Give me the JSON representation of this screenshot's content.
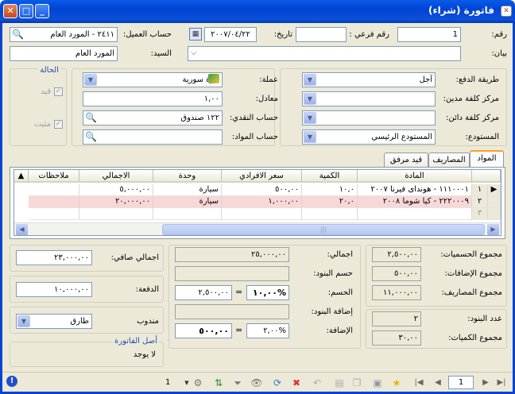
{
  "window": {
    "title": "فاتورة (شراء)",
    "close_glyph": "✕",
    "max_glyph": "□",
    "min_glyph": "_",
    "app_glyph": "✕"
  },
  "header": {
    "number_label": "رقم:",
    "number_value": "1",
    "subnumber_label": "رقم فرعي :",
    "subnumber_value": "",
    "date_label": "تاريخ:",
    "date_value": "٢٠٠٧/٠٤/٢٢",
    "customer_label": "حساب العميل:",
    "customer_value": "٢٤١١ - المورد العام",
    "statement_label": "بيان:",
    "statement_value": "",
    "mister_label": "السيد:",
    "mister_value": "المورد العام"
  },
  "payment": {
    "method_label": "طريقة الدفع:",
    "method_value": "آجل",
    "debit_center_label": "مركز كلفة مدين:",
    "debit_center_value": "",
    "credit_center_label": "مركز كلفة دائن:",
    "credit_center_value": "",
    "warehouse_label": "المستودع:",
    "warehouse_value": "المستودع الرئيسي"
  },
  "currency": {
    "currency_label": "عملة:",
    "currency_value": "ليرة سورية",
    "rate_label": "معادل:",
    "rate_value": "١,٠٠",
    "cash_label": "حساب النقدي:",
    "cash_value": "١٢٢ صندوق",
    "materials_label": "حساب المواد:",
    "materials_value": ""
  },
  "status": {
    "title": "الحالة",
    "registered_label": "قيد",
    "posted_label": "مثبت"
  },
  "tabs": [
    {
      "label": "المواد"
    },
    {
      "label": "المصاريف"
    },
    {
      "label": "قيد مرفق"
    }
  ],
  "grid": {
    "headers": [
      "المادة",
      "الكمية",
      "سعر الافرادي",
      "وحدة",
      "الاجمالي",
      "ملاحظات"
    ],
    "rows": [
      {
        "num": "١",
        "material": "١١١٠٠٠١ - هوندای فيرنا ٢٠٠٧",
        "qty": "١٠,٠",
        "price": "٥٠٠,٠٠",
        "unit": "سيارة",
        "total": "٥,٠٠٠,٠٠",
        "notes": ""
      },
      {
        "num": "٢",
        "material": "٢٢٢٠٠٠٩ - كيا شوما ٢٠٠٨",
        "qty": "٢٠,٠",
        "price": "١,٠٠٠,٠٠",
        "unit": "سيارة",
        "total": "٢٠,٠٠٠,٠٠",
        "notes": ""
      },
      {
        "num": "٣",
        "material": "",
        "qty": "",
        "price": "",
        "unit": "",
        "total": "",
        "notes": ""
      }
    ]
  },
  "totals_left": {
    "net_label": "اجمالي صافي:",
    "net_value": "٢٣,٠٠٠,٠٠",
    "paid_label": "الدفعة:",
    "paid_value": "١٠,٠٠٠,٠٠",
    "rep_label": "مندوب",
    "rep_value": "طارق",
    "origin_label": "أصل الفاتورة",
    "origin_value": "لا يوجد"
  },
  "totals_mid": {
    "total_label": "اجمالي:",
    "total_value": "٢٥,٠٠٠,٠٠",
    "item_disc_label": "حسم البنود:",
    "item_disc_value": "",
    "disc_label": "الحسم:",
    "disc_pct": "%١٠,٠٠",
    "disc_value": "٢,٥٠٠,٠٠",
    "eq": "=",
    "item_add_label": "إضافة البنود:",
    "item_add_value": "",
    "add_label": "الإضافة:",
    "add_pct": "%٢,٠٠",
    "add_value": "٥٠٠,٠٠"
  },
  "totals_right": {
    "disc_sum_label": "مجموع الحسميات:",
    "disc_sum_value": "٢,٥٠٠,٠٠",
    "add_sum_label": "مجموع الإضافات:",
    "add_sum_value": "٥٠٠,٠٠",
    "exp_sum_label": "مجموع المصاريف:",
    "exp_sum_value": "١١,٠٠٠,٠٠",
    "items_count_label": "عدد البنود:",
    "items_count_value": "٢",
    "qty_sum_label": "مجموع الكميات:",
    "qty_sum_value": "٣٠,٠٠"
  },
  "toolbar": {
    "page_value": "1",
    "record_value": "1"
  }
}
